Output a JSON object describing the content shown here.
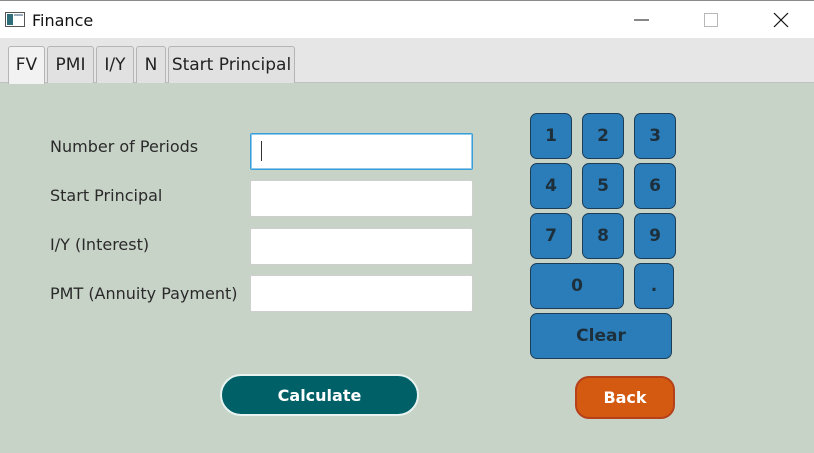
{
  "window": {
    "title": "Finance"
  },
  "tabs": [
    {
      "label": "FV"
    },
    {
      "label": "PMI"
    },
    {
      "label": "I/Y"
    },
    {
      "label": "N"
    },
    {
      "label": "Start Principal"
    }
  ],
  "form": {
    "fields": [
      {
        "label": "Number of Periods",
        "value": ""
      },
      {
        "label": "Start Principal",
        "value": ""
      },
      {
        "label": "I/Y (Interest)",
        "value": ""
      },
      {
        "label": "PMT (Annuity Payment)",
        "value": ""
      }
    ],
    "calculate_label": "Calculate"
  },
  "keypad": {
    "keys": [
      "1",
      "2",
      "3",
      "4",
      "5",
      "6",
      "7",
      "8",
      "9",
      "0",
      "."
    ],
    "clear_label": "Clear"
  },
  "back_label": "Back",
  "colors": {
    "background": "#c8d3c8",
    "key": "#2a7db8",
    "calculate": "#006068",
    "back": "#d45a12"
  }
}
